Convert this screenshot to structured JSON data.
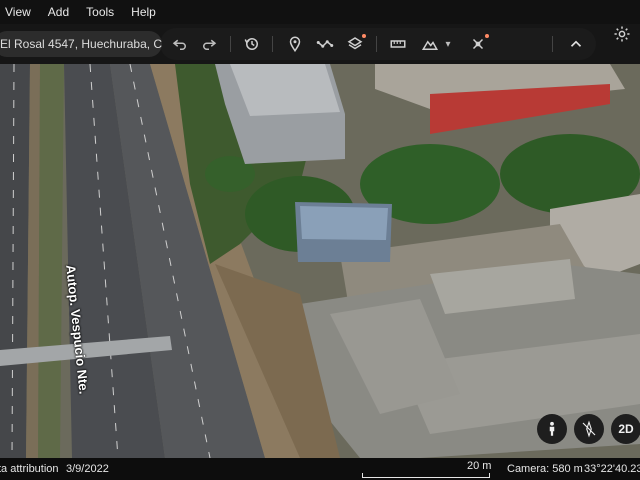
{
  "menu": {
    "items": [
      {
        "label": "View"
      },
      {
        "label": "Add"
      },
      {
        "label": "Tools"
      },
      {
        "label": "Help"
      }
    ]
  },
  "search": {
    "value": "El Rosal 4547, Huechuraba, C"
  },
  "map": {
    "road_label": "Autop. Vespucio Nte."
  },
  "status": {
    "attribution": "ta attribution",
    "date": "3/9/2022",
    "scale": "20 m",
    "camera": "Camera: 580 m",
    "coords": "33°22'40.23\""
  },
  "map_buttons": {
    "mode_2d": "2D"
  },
  "colors": {
    "accent_dot": "#ff8a65",
    "toolbar_bg": "#161616"
  },
  "icons": {
    "toolbar": [
      "undo-icon",
      "redo-icon",
      "history-icon",
      "placemark-icon",
      "path-icon",
      "layers-icon",
      "ruler-icon",
      "elevation-icon",
      "satellite-icon",
      "chevron-up-icon",
      "settings-icon"
    ]
  }
}
